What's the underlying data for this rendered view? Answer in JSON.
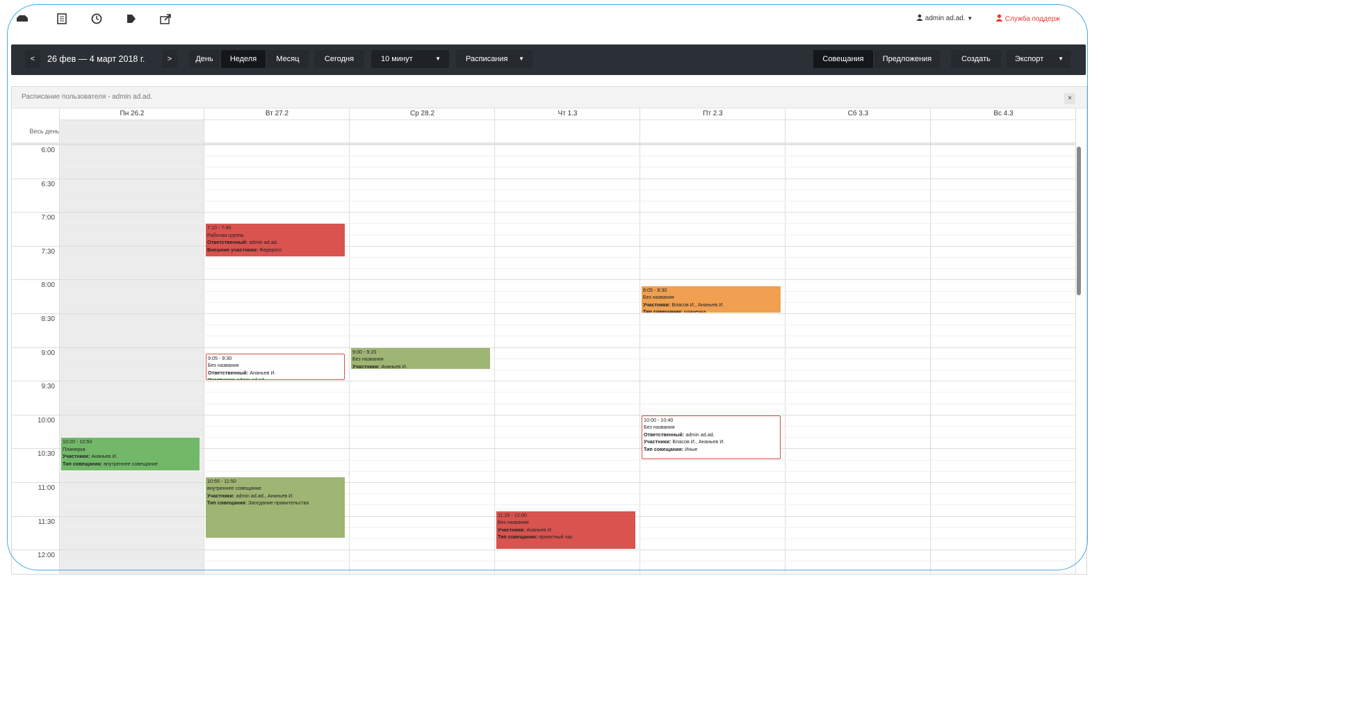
{
  "topbar": {
    "icons": [
      "inbox-icon",
      "document-icon",
      "clock-icon",
      "tag-icon",
      "share-icon"
    ],
    "user": "admin ad.ad.",
    "support": "Служба поддерж"
  },
  "toolbar": {
    "prev": "<",
    "range": "26 фев — 4 март 2018 г.",
    "next": ">",
    "day": "День",
    "week": "Неделя",
    "month": "Месяц",
    "today": "Сегодня",
    "interval": "10 минут",
    "schedules": "Расписания",
    "meetings": "Совещания",
    "proposals": "Предложения",
    "create": "Создать",
    "export": "Экспорт"
  },
  "panel": {
    "title": "Расписание пользователя - admin ad.ad.",
    "close": "×",
    "allday": "Весь день"
  },
  "days": [
    "Пн 26.2",
    "Вт 27.2",
    "Ср 28.2",
    "Чт 1.3",
    "Пт 2.3",
    "Сб 3.3",
    "Вс 4.3"
  ],
  "times": [
    "6:00",
    "6:30",
    "7:00",
    "7:30",
    "8:00",
    "8:30",
    "9:00",
    "9:30",
    "10:00",
    "10:30",
    "11:00",
    "11:30",
    "12:00"
  ],
  "events": [
    {
      "day": 1,
      "start": "7:10",
      "end": "7:40",
      "style": "red",
      "time": "7:10 - 7:40",
      "title": "Рабочая группа",
      "fields": [
        {
          "label": "Ответственный:",
          "value": "admin ad.ad."
        },
        {
          "label": "Внешние участники:",
          "value": "Федпресс"
        }
      ]
    },
    {
      "day": 4,
      "start": "8:05",
      "end": "8:30",
      "style": "orange",
      "time": "8:05 - 8:30",
      "title": "Без названия",
      "fields": [
        {
          "label": "Участники:",
          "value": "Власов И., Ананьев И."
        },
        {
          "label": "Тип совещания:",
          "value": "планерка"
        }
      ]
    },
    {
      "day": 1,
      "start": "9:05",
      "end": "9:30",
      "style": "outline",
      "time": "9:05 - 9:30",
      "title": "Без названия",
      "fields": [
        {
          "label": "Ответственный:",
          "value": "Ананьев И."
        },
        {
          "label": "Участники:",
          "value": "admin ad.ad."
        }
      ]
    },
    {
      "day": 2,
      "start": "9:00",
      "end": "9:20",
      "style": "olive",
      "time": "9:00 - 9:20",
      "title": "Без названия",
      "fields": [
        {
          "label": "Участники:",
          "value": "Ананьев И."
        }
      ]
    },
    {
      "day": 4,
      "start": "10:00",
      "end": "10:40",
      "style": "outline",
      "time": "10:00 - 10:40",
      "title": "Без названия",
      "fields": [
        {
          "label": "Ответственный:",
          "value": "admin ad.ad."
        },
        {
          "label": "Участники:",
          "value": "Власов И., Ананьев И."
        },
        {
          "label": "Тип совещания:",
          "value": "Иные"
        }
      ]
    },
    {
      "day": 0,
      "start": "10:20",
      "end": "10:50",
      "style": "green",
      "time": "10:20 - 10:50",
      "title": "Планерка",
      "fields": [
        {
          "label": "Участники:",
          "value": "Ананьев И."
        },
        {
          "label": "Тип совещания:",
          "value": "внутреннее совещание"
        }
      ]
    },
    {
      "day": 1,
      "start": "10:55",
      "end": "11:50",
      "style": "olive",
      "time": "10:55 - 11:50",
      "title": "внутреннее совещание",
      "fields": [
        {
          "label": "Участники:",
          "value": "admin ad.ad., Ананьев И."
        },
        {
          "label": "Тип совещания:",
          "value": "Заседание правительства"
        }
      ]
    },
    {
      "day": 3,
      "start": "11:25",
      "end": "12:00",
      "style": "red",
      "time": "11:25 - 12:00",
      "title": "Без названия",
      "fields": [
        {
          "label": "Участники:",
          "value": "Ананьев И."
        },
        {
          "label": "Тип совещания:",
          "value": "проектный час"
        }
      ]
    }
  ]
}
